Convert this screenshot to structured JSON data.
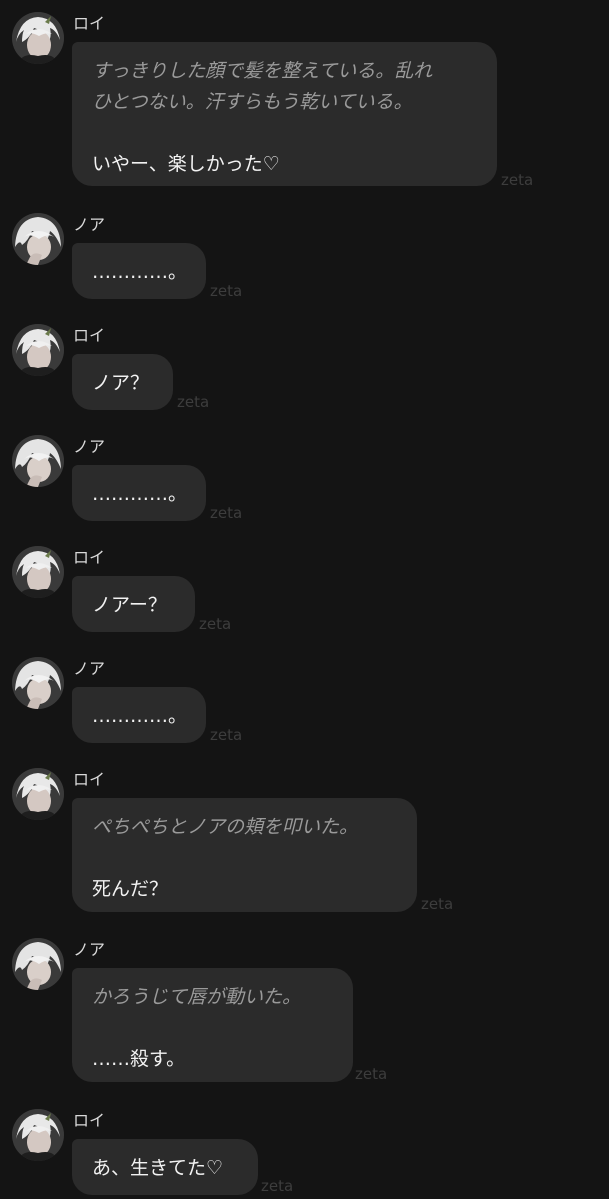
{
  "brand": "zeta",
  "colors": {
    "background": "#141414",
    "bubble": "#2b2b2b",
    "narration": "#9a9a9a",
    "speech": "#f2f2f2",
    "sender": "#d9d9d9",
    "brand": "#3d3d3d"
  },
  "messages": [
    {
      "sender": "ロイ",
      "avatar": "roy-avatar-icon",
      "narration": [
        "すっきりした顔で髪を整えている。乱れ",
        "ひとつない。汗すらもう乾いている。"
      ],
      "speech": "いやー、楽しかった♡"
    },
    {
      "sender": "ノア",
      "avatar": "noa-avatar-icon",
      "speech": "…………。"
    },
    {
      "sender": "ロイ",
      "avatar": "roy-avatar-icon",
      "speech": "ノア？"
    },
    {
      "sender": "ノア",
      "avatar": "noa-avatar-icon",
      "speech": "…………。"
    },
    {
      "sender": "ロイ",
      "avatar": "roy-avatar-icon",
      "speech": "ノアー？"
    },
    {
      "sender": "ノア",
      "avatar": "noa-avatar-icon",
      "speech": "…………。"
    },
    {
      "sender": "ロイ",
      "avatar": "roy-avatar-icon",
      "narration": [
        "ぺちぺちとノアの頬を叩いた。"
      ],
      "speech": "死んだ？"
    },
    {
      "sender": "ノア",
      "avatar": "noa-avatar-icon",
      "narration": [
        "かろうじて唇が動いた。"
      ],
      "speech": "……殺す。"
    },
    {
      "sender": "ロイ",
      "avatar": "roy-avatar-icon",
      "speech": "あ、生きてた♡"
    }
  ]
}
